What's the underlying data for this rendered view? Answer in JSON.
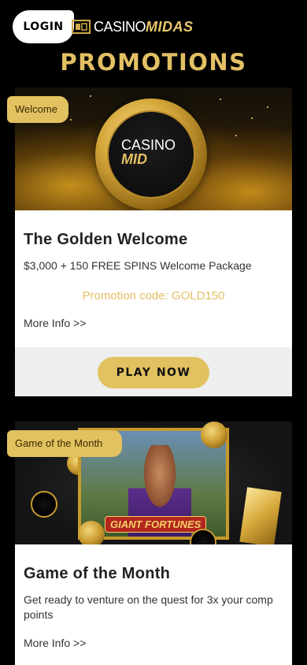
{
  "header": {
    "login_label": "LOGIN",
    "logo_casino": "CASINO",
    "logo_midas": "MIDAS"
  },
  "page_title": "PROMOTIONS",
  "promotions": [
    {
      "tag": "Welcome",
      "title": "The Golden Welcome",
      "description": "$3,000 + 150 FREE SPINS Welcome Package",
      "promo_code": "Promotion code: GOLD150",
      "more_info": "More Info >>",
      "cta": "PLAY NOW",
      "banner_coin_top": "CASINO",
      "banner_coin_bottom": "MID"
    },
    {
      "tag": "Game of the Month",
      "title": "Game of the Month",
      "description": "Get ready to venture on the quest for 3x your comp points",
      "more_info": "More Info >>",
      "banner_game_logo": "GIANT FORTUNES"
    }
  ],
  "colors": {
    "accent_gold": "#e2c260",
    "background": "#000000",
    "card_footer": "#efefef"
  }
}
